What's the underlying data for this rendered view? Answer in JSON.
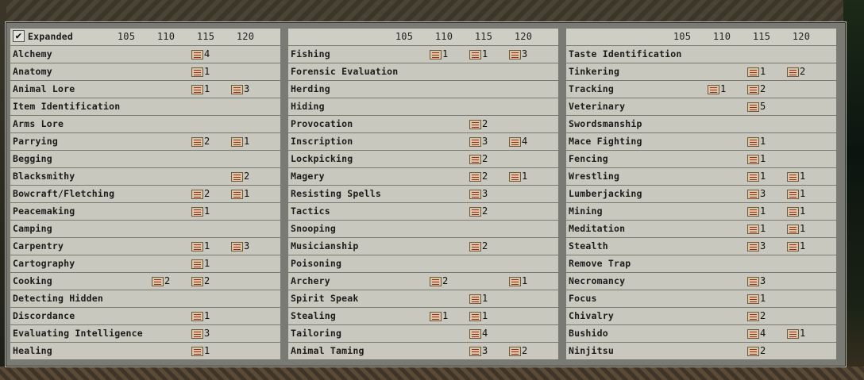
{
  "expanded_label": "Expanded",
  "columns": [
    "105",
    "110",
    "115",
    "120"
  ],
  "panels": [
    {
      "skills": [
        {
          "name": "Alchemy",
          "c105": "",
          "c110": "",
          "c115": "4",
          "c120": ""
        },
        {
          "name": "Anatomy",
          "c105": "",
          "c110": "",
          "c115": "1",
          "c120": ""
        },
        {
          "name": "Animal Lore",
          "c105": "",
          "c110": "",
          "c115": "1",
          "c120": "3"
        },
        {
          "name": "Item Identification",
          "c105": "",
          "c110": "",
          "c115": "",
          "c120": ""
        },
        {
          "name": "Arms Lore",
          "c105": "",
          "c110": "",
          "c115": "",
          "c120": ""
        },
        {
          "name": "Parrying",
          "c105": "",
          "c110": "",
          "c115": "2",
          "c120": "1"
        },
        {
          "name": "Begging",
          "c105": "",
          "c110": "",
          "c115": "",
          "c120": ""
        },
        {
          "name": "Blacksmithy",
          "c105": "",
          "c110": "",
          "c115": "",
          "c120": "2"
        },
        {
          "name": "Bowcraft/Fletching",
          "c105": "",
          "c110": "",
          "c115": "2",
          "c120": "1"
        },
        {
          "name": "Peacemaking",
          "c105": "",
          "c110": "",
          "c115": "1",
          "c120": ""
        },
        {
          "name": "Camping",
          "c105": "",
          "c110": "",
          "c115": "",
          "c120": ""
        },
        {
          "name": "Carpentry",
          "c105": "",
          "c110": "",
          "c115": "1",
          "c120": "3"
        },
        {
          "name": "Cartography",
          "c105": "",
          "c110": "",
          "c115": "1",
          "c120": ""
        },
        {
          "name": "Cooking",
          "c105": "",
          "c110": "2",
          "c115": "2",
          "c120": ""
        },
        {
          "name": "Detecting Hidden",
          "c105": "",
          "c110": "",
          "c115": "",
          "c120": ""
        },
        {
          "name": "Discordance",
          "c105": "",
          "c110": "",
          "c115": "1",
          "c120": ""
        },
        {
          "name": "Evaluating Intelligence",
          "c105": "",
          "c110": "",
          "c115": "3",
          "c120": ""
        },
        {
          "name": "Healing",
          "c105": "",
          "c110": "",
          "c115": "1",
          "c120": ""
        }
      ]
    },
    {
      "skills": [
        {
          "name": "Fishing",
          "c105": "",
          "c110": "1",
          "c115": "1",
          "c120": "3"
        },
        {
          "name": "Forensic Evaluation",
          "c105": "",
          "c110": "",
          "c115": "",
          "c120": ""
        },
        {
          "name": "Herding",
          "c105": "",
          "c110": "",
          "c115": "",
          "c120": ""
        },
        {
          "name": "Hiding",
          "c105": "",
          "c110": "",
          "c115": "",
          "c120": ""
        },
        {
          "name": "Provocation",
          "c105": "",
          "c110": "",
          "c115": "2",
          "c120": ""
        },
        {
          "name": "Inscription",
          "c105": "",
          "c110": "",
          "c115": "3",
          "c120": "4"
        },
        {
          "name": "Lockpicking",
          "c105": "",
          "c110": "",
          "c115": "2",
          "c120": ""
        },
        {
          "name": "Magery",
          "c105": "",
          "c110": "",
          "c115": "2",
          "c120": "1"
        },
        {
          "name": "Resisting Spells",
          "c105": "",
          "c110": "",
          "c115": "3",
          "c120": ""
        },
        {
          "name": "Tactics",
          "c105": "",
          "c110": "",
          "c115": "2",
          "c120": ""
        },
        {
          "name": "Snooping",
          "c105": "",
          "c110": "",
          "c115": "",
          "c120": ""
        },
        {
          "name": "Musicianship",
          "c105": "",
          "c110": "",
          "c115": "2",
          "c120": ""
        },
        {
          "name": "Poisoning",
          "c105": "",
          "c110": "",
          "c115": "",
          "c120": ""
        },
        {
          "name": "Archery",
          "c105": "",
          "c110": "2",
          "c115": "",
          "c120": "1"
        },
        {
          "name": "Spirit Speak",
          "c105": "",
          "c110": "",
          "c115": "1",
          "c120": ""
        },
        {
          "name": "Stealing",
          "c105": "",
          "c110": "1",
          "c115": "1",
          "c120": ""
        },
        {
          "name": "Tailoring",
          "c105": "",
          "c110": "",
          "c115": "4",
          "c120": ""
        },
        {
          "name": "Animal Taming",
          "c105": "",
          "c110": "",
          "c115": "3",
          "c120": "2"
        }
      ]
    },
    {
      "skills": [
        {
          "name": "Taste Identification",
          "c105": "",
          "c110": "",
          "c115": "",
          "c120": ""
        },
        {
          "name": "Tinkering",
          "c105": "",
          "c110": "",
          "c115": "1",
          "c120": "2"
        },
        {
          "name": "Tracking",
          "c105": "",
          "c110": "1",
          "c115": "2",
          "c120": ""
        },
        {
          "name": "Veterinary",
          "c105": "",
          "c110": "",
          "c115": "5",
          "c120": ""
        },
        {
          "name": "Swordsmanship",
          "c105": "",
          "c110": "",
          "c115": "",
          "c120": ""
        },
        {
          "name": "Mace Fighting",
          "c105": "",
          "c110": "",
          "c115": "1",
          "c120": ""
        },
        {
          "name": "Fencing",
          "c105": "",
          "c110": "",
          "c115": "1",
          "c120": ""
        },
        {
          "name": "Wrestling",
          "c105": "",
          "c110": "",
          "c115": "1",
          "c120": "1"
        },
        {
          "name": "Lumberjacking",
          "c105": "",
          "c110": "",
          "c115": "3",
          "c120": "1"
        },
        {
          "name": "Mining",
          "c105": "",
          "c110": "",
          "c115": "1",
          "c120": "1"
        },
        {
          "name": "Meditation",
          "c105": "",
          "c110": "",
          "c115": "1",
          "c120": "1"
        },
        {
          "name": "Stealth",
          "c105": "",
          "c110": "",
          "c115": "3",
          "c120": "1"
        },
        {
          "name": "Remove Trap",
          "c105": "",
          "c110": "",
          "c115": "",
          "c120": ""
        },
        {
          "name": "Necromancy",
          "c105": "",
          "c110": "",
          "c115": "3",
          "c120": ""
        },
        {
          "name": "Focus",
          "c105": "",
          "c110": "",
          "c115": "1",
          "c120": ""
        },
        {
          "name": "Chivalry",
          "c105": "",
          "c110": "",
          "c115": "2",
          "c120": ""
        },
        {
          "name": "Bushido",
          "c105": "",
          "c110": "",
          "c115": "4",
          "c120": "1"
        },
        {
          "name": "Ninjitsu",
          "c105": "",
          "c110": "",
          "c115": "2",
          "c120": ""
        }
      ]
    }
  ],
  "icons": {
    "scroll": "scroll-icon",
    "check": "check-icon"
  }
}
